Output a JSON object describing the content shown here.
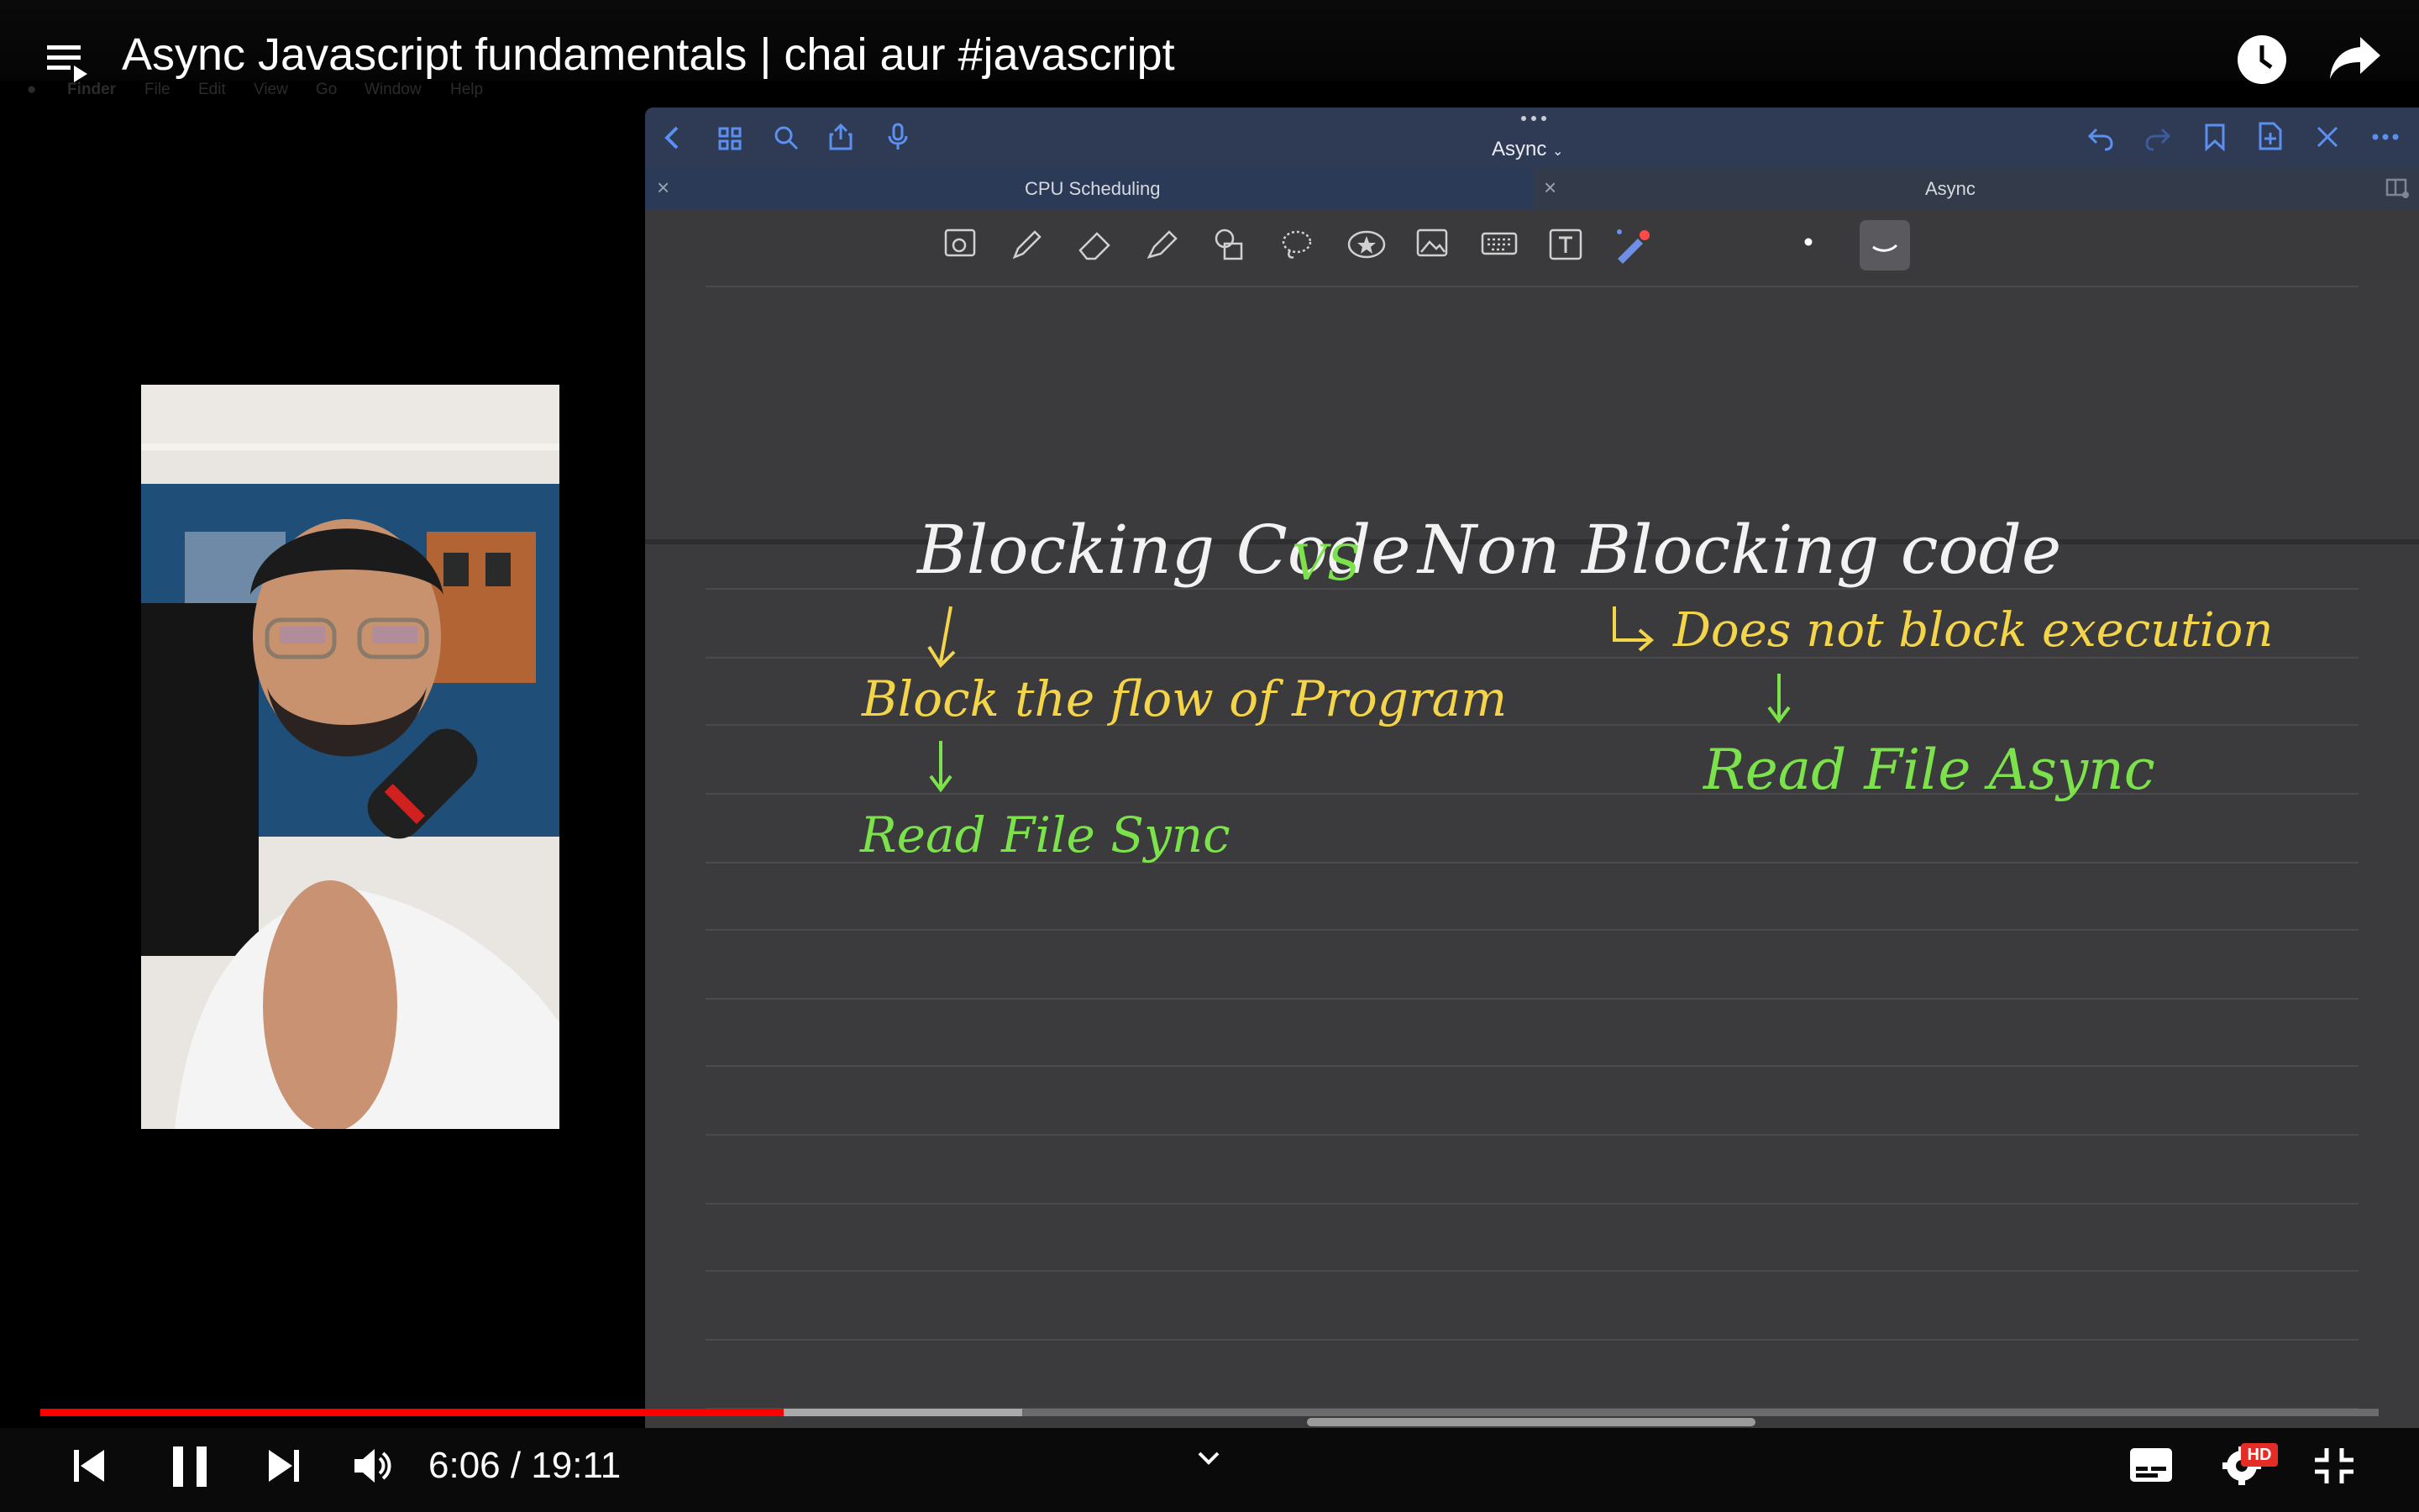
{
  "player": {
    "title": "Async Javascript fundamentals | chai aur #javascript",
    "time_current": "6:06",
    "time_sep": " / ",
    "time_total": "19:11",
    "progress_fraction": 0.318,
    "buffer_fraction": 0.42,
    "quality_badge": "HD"
  },
  "mac_menu": {
    "items": [
      "Finder",
      "File",
      "Edit",
      "View",
      "Go",
      "Window",
      "Help"
    ]
  },
  "notes_app": {
    "doc_title": "Async",
    "tabs": [
      {
        "label": "CPU Scheduling"
      },
      {
        "label": "Async"
      }
    ]
  },
  "notes": {
    "heading_left": "Blocking Code",
    "heading_vs": "VS",
    "heading_right": "Non Blocking code",
    "left_point": "Block the flow of Program",
    "left_example": "Read File Sync",
    "right_point": "Does not block execution",
    "right_example": "Read File Async"
  },
  "colors": {
    "accent_red": "#ff0000",
    "note_white": "#f2f2f2",
    "note_yellow": "#f4d54a",
    "note_green": "#7be24b",
    "app_header": "#2f3b55"
  }
}
